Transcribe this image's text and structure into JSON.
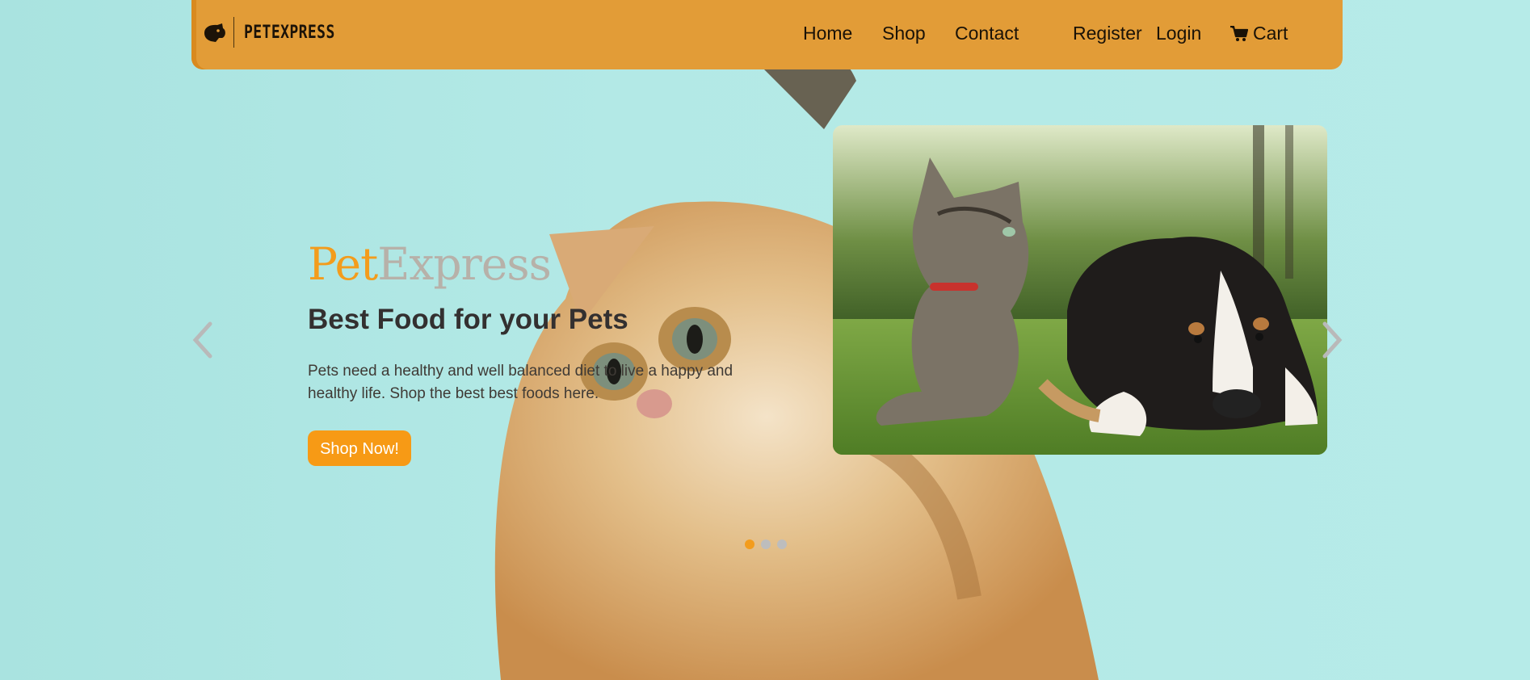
{
  "colors": {
    "navbar_bg": "#e29c37",
    "accent_orange": "#f39c1c",
    "express_gray": "#b7b1a9",
    "page_bg": "#b3e9e6"
  },
  "navbar": {
    "brand_text": "PETEXPRESS",
    "links": {
      "home": "Home",
      "shop": "Shop",
      "contact": "Contact",
      "register": "Register",
      "login": "Login",
      "cart": "Cart"
    },
    "icons": {
      "logo": "dog-head-logo-icon",
      "cart": "shopping-cart-icon"
    }
  },
  "hero": {
    "brand_pet": "Pet",
    "brand_express": "Express",
    "heading": "Best Food for your Pets",
    "description": "Pets need a healthy and well balanced diet to live a happy and healthy life. Shop the best best foods here.",
    "cta_label": "Shop Now!"
  },
  "carousel": {
    "prev_icon": "chevron-left-icon",
    "next_icon": "chevron-right-icon",
    "slide_count": 3,
    "active_slide": 1
  }
}
